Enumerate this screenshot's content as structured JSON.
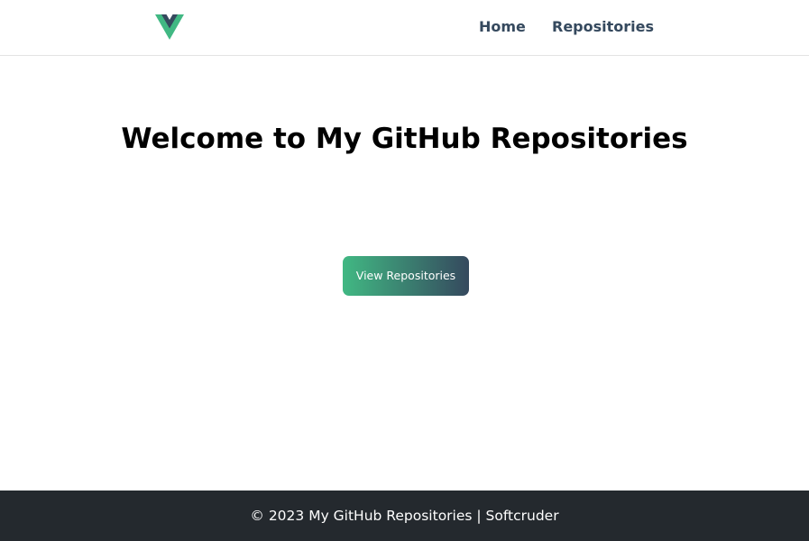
{
  "navbar": {
    "logo_icon": "vue-logo-icon",
    "links": [
      {
        "label": "Home"
      },
      {
        "label": "Repositories"
      }
    ]
  },
  "main": {
    "title": "Welcome to My GitHub Repositories",
    "cta_label": "View Repositories"
  },
  "footer": {
    "text": "© 2023 My GitHub Repositories | Softcruder"
  },
  "colors": {
    "brand_green": "#41b883",
    "brand_navy": "#35495e",
    "footer_bg": "#24292e"
  }
}
